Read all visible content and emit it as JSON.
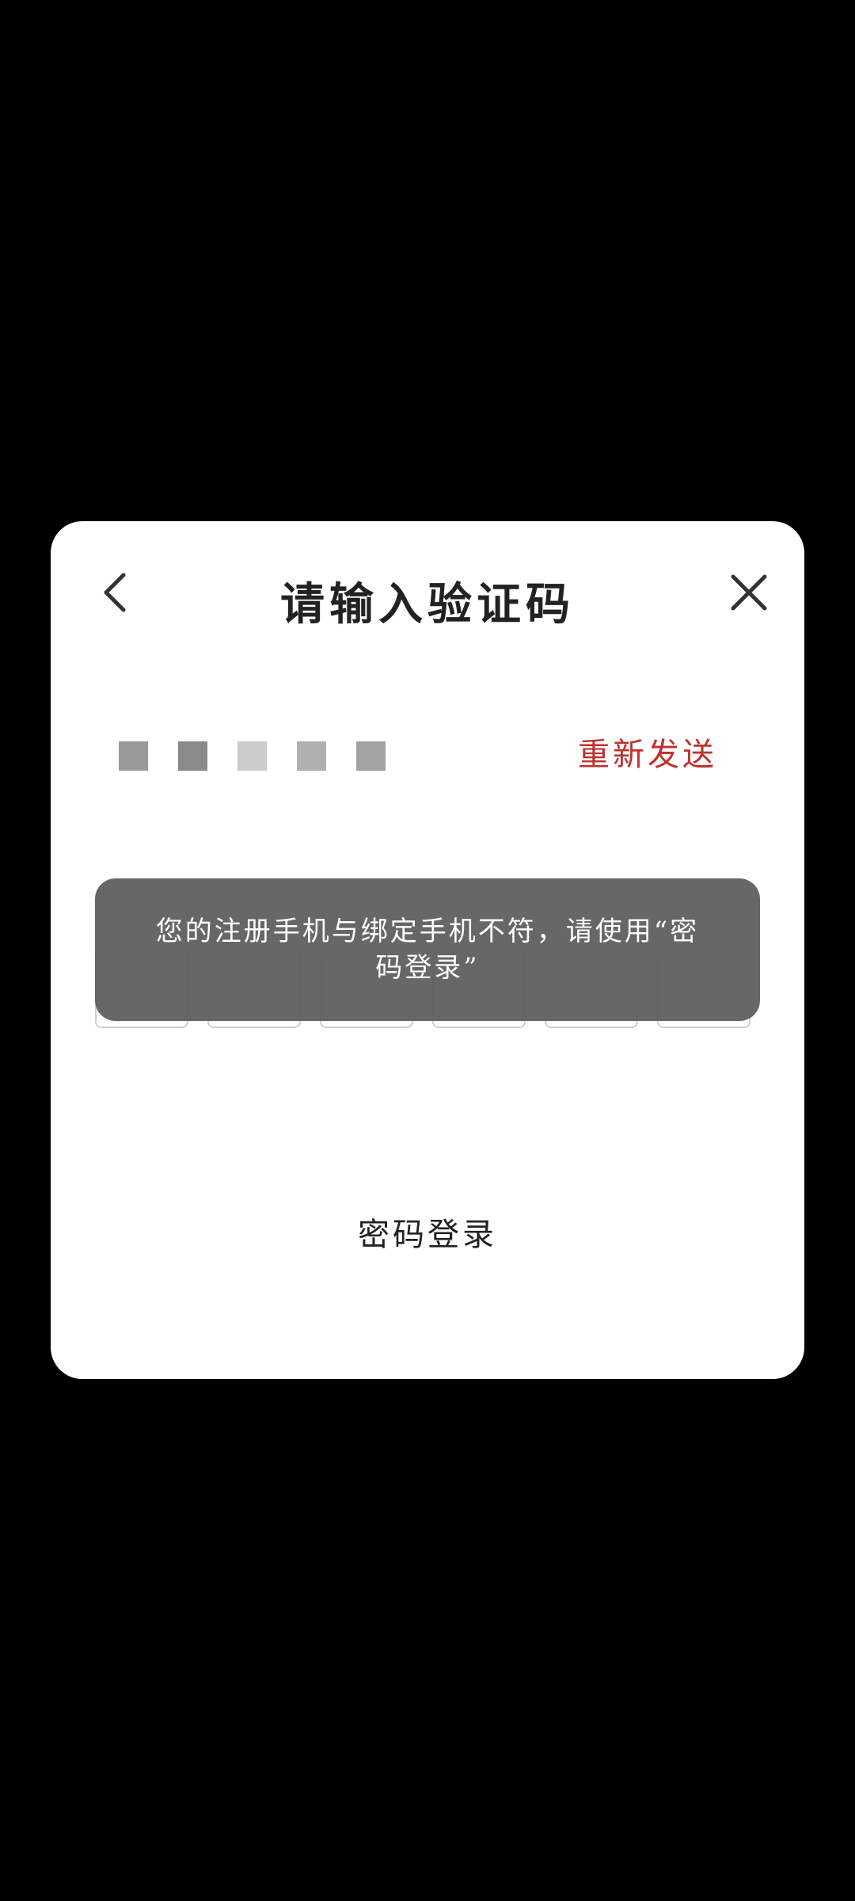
{
  "dialog": {
    "title": "请输入验证码",
    "back_icon": "chevron-left-icon",
    "close_icon": "close-icon",
    "masked_phone_colors": [
      "#9a9a9a",
      "#8a8a8a",
      "#cbcbcb",
      "#b0b0b0",
      "#a2a2a2"
    ],
    "resend_label": "重新发送",
    "resend_color": "#c0302c",
    "code_box_count": 6,
    "toast_message": "您的注册手机与绑定手机不符，请使用“密码登录”",
    "password_login_label": "密码登录"
  }
}
